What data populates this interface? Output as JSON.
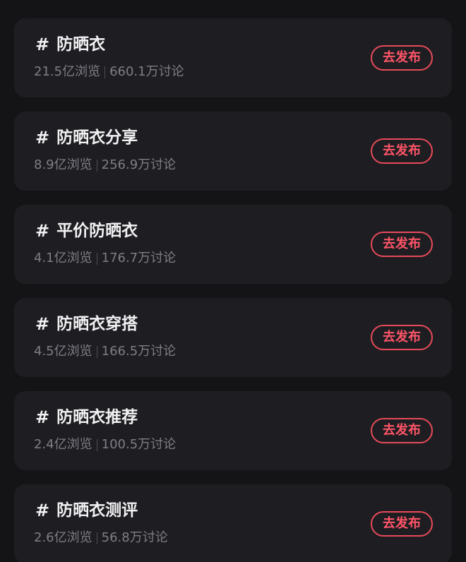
{
  "publish_label": "去发布",
  "topics": [
    {
      "hash": "#",
      "title": "防晒衣",
      "views": "21.5亿浏览",
      "discussions": "660.1万讨论"
    },
    {
      "hash": "#",
      "title": "防晒衣分享",
      "views": "8.9亿浏览",
      "discussions": "256.9万讨论"
    },
    {
      "hash": "#",
      "title": "平价防晒衣",
      "views": "4.1亿浏览",
      "discussions": "176.7万讨论"
    },
    {
      "hash": "#",
      "title": "防晒衣穿搭",
      "views": "4.5亿浏览",
      "discussions": "166.5万讨论"
    },
    {
      "hash": "#",
      "title": "防晒衣推荐",
      "views": "2.4亿浏览",
      "discussions": "100.5万讨论"
    },
    {
      "hash": "#",
      "title": "防晒衣测评",
      "views": "2.6亿浏览",
      "discussions": "56.8万讨论"
    }
  ],
  "colors": {
    "background": "#141417",
    "card": "#1e1e22",
    "title": "#f1f1f3",
    "stats": "#7d7d85",
    "accent": "#ff5568"
  }
}
